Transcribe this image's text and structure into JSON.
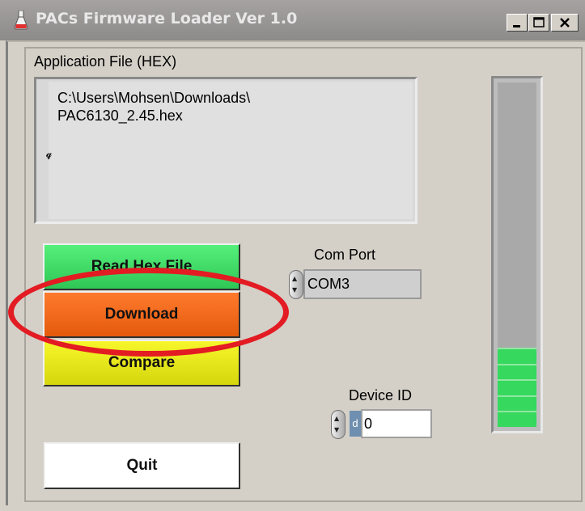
{
  "window": {
    "title": "PACs Firmware Loader Ver 1.0"
  },
  "file": {
    "label": "Application File (HEX)",
    "path": "C:\\Users\\Mohsen\\Downloads\\\nPAC6130_2.45.hex"
  },
  "buttons": {
    "read_hex": "Read Hex File",
    "download": "Download",
    "compare": "Compare",
    "quit": "Quit"
  },
  "com_port": {
    "label": "Com Port",
    "value": "COM3"
  },
  "device_id": {
    "label": "Device ID",
    "radix": "d",
    "value": "0"
  },
  "progress": {
    "level_fraction": 0.23,
    "segments": 5,
    "fill_color": "#36d85e"
  },
  "annotation": {
    "highlight_color": "#e31b23",
    "target": "download"
  },
  "icons": {
    "app": "flask-icon",
    "minimize": "minimize-icon",
    "maximize": "maximize-icon",
    "close": "close-icon"
  }
}
